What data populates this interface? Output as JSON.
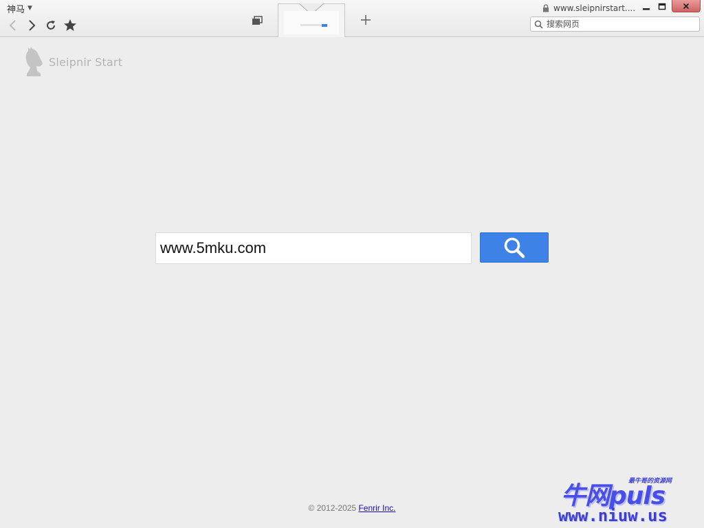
{
  "browser": {
    "app_menu_label": "神马",
    "address_url": "www.sleipnirstart....",
    "search_placeholder": "搜索网页",
    "icons": {
      "back": "chevron-left-icon",
      "forward": "chevron-right-icon",
      "reload": "reload-icon",
      "bookmark": "star-icon",
      "tab_group": "tab-group-icon",
      "new_tab": "plus-icon",
      "lock": "lock-icon",
      "search": "search-icon",
      "minimize": "minimize-icon",
      "maximize": "maximize-icon",
      "close": "close-icon"
    },
    "colors": {
      "close_button": "#d06a6a",
      "chrome_bg": "#efefef"
    }
  },
  "page": {
    "logo_text": "Sleipnir Start",
    "search_value": "www.5mku.com",
    "search_button_icon": "search-icon",
    "footer_copyright": "© 2012-2025 ",
    "footer_link": "Fenrir Inc.",
    "colors": {
      "search_button": "#3e82e8",
      "page_bg": "#ededed"
    }
  },
  "watermark": {
    "brand": "牛网puls",
    "tagline": "最牛哥的资源网",
    "url": "www.niuw.us"
  }
}
